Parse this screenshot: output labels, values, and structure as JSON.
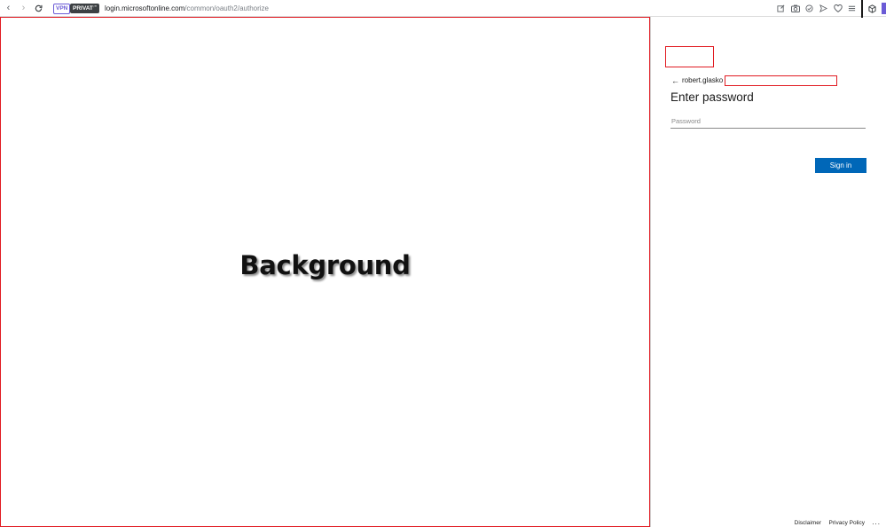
{
  "browser": {
    "vpn_badge": "VPN",
    "private_badge": "PRIVATE",
    "url_host": "login.microsoftonline.com",
    "url_path": "/common/oauth2/authorize",
    "icons": [
      "back-icon",
      "forward-icon",
      "reload-icon",
      "lock-icon",
      "edit-icon",
      "camera-icon",
      "check-circle-icon",
      "send-icon",
      "heart-icon",
      "menu-icon",
      "extension-icon"
    ]
  },
  "background": {
    "label": "Background"
  },
  "signin": {
    "email_prefix": "robert.glasko",
    "title": "Enter password",
    "password_placeholder": "Password",
    "button_label": "Sign in",
    "accent_color": "#0067b8"
  },
  "footer": {
    "disclaimer": "Disclaimer",
    "privacy": "Privacy Policy",
    "more": "..."
  },
  "annotation_color": "#e11b22"
}
